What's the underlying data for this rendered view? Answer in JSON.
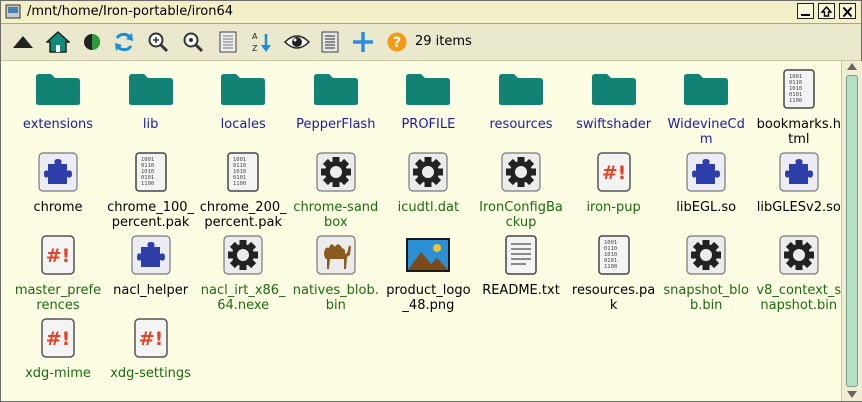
{
  "window": {
    "title": "/mnt/home/Iron-portable/iron64"
  },
  "toolbar": {
    "item_count": "29 items"
  },
  "files": [
    {
      "name": "extensions",
      "icon": "folder-icon",
      "kind": "dir"
    },
    {
      "name": "lib",
      "icon": "folder-icon",
      "kind": "dir"
    },
    {
      "name": "locales",
      "icon": "folder-icon",
      "kind": "dir"
    },
    {
      "name": "PepperFlash",
      "icon": "folder-icon",
      "kind": "dir"
    },
    {
      "name": "PROFILE",
      "icon": "folder-icon",
      "kind": "dir"
    },
    {
      "name": "resources",
      "icon": "folder-icon",
      "kind": "dir"
    },
    {
      "name": "swiftshader",
      "icon": "folder-icon",
      "kind": "dir"
    },
    {
      "name": "WidevineCdm",
      "icon": "folder-icon",
      "kind": "dir"
    },
    {
      "name": "bookmarks.html",
      "icon": "binary-file-icon",
      "kind": "file"
    },
    {
      "name": "chrome",
      "icon": "puzzle-icon",
      "kind": "file"
    },
    {
      "name": "chrome_100_percent.pak",
      "icon": "binary-file-icon",
      "kind": "file"
    },
    {
      "name": "chrome_200_percent.pak",
      "icon": "binary-file-icon",
      "kind": "file"
    },
    {
      "name": "chrome-sandbox",
      "icon": "gear-icon",
      "kind": "exec"
    },
    {
      "name": "icudtl.dat",
      "icon": "gear-icon",
      "kind": "exec"
    },
    {
      "name": "IronConfigBackup",
      "icon": "gear-icon",
      "kind": "exec"
    },
    {
      "name": "iron-pup",
      "icon": "script-icon",
      "kind": "exec"
    },
    {
      "name": "libEGL.so",
      "icon": "puzzle-icon",
      "kind": "file"
    },
    {
      "name": "libGLESv2.so",
      "icon": "puzzle-icon",
      "kind": "file"
    },
    {
      "name": "master_preferences",
      "icon": "script-icon",
      "kind": "exec"
    },
    {
      "name": "nacl_helper",
      "icon": "puzzle-icon",
      "kind": "file"
    },
    {
      "name": "nacl_irt_x86_64.nexe",
      "icon": "gear-icon",
      "kind": "exec"
    },
    {
      "name": "natives_blob.bin",
      "icon": "camel-icon",
      "kind": "exec"
    },
    {
      "name": "product_logo_48.png",
      "icon": "image-icon",
      "kind": "file"
    },
    {
      "name": "README.txt",
      "icon": "text-file-icon",
      "kind": "file"
    },
    {
      "name": "resources.pak",
      "icon": "binary-file-icon",
      "kind": "file"
    },
    {
      "name": "snapshot_blob.bin",
      "icon": "gear-icon",
      "kind": "exec"
    },
    {
      "name": "v8_context_snapshot.bin",
      "icon": "gear-icon",
      "kind": "exec"
    },
    {
      "name": "xdg-mime",
      "icon": "script-icon",
      "kind": "exec"
    },
    {
      "name": "xdg-settings",
      "icon": "script-icon",
      "kind": "exec"
    }
  ],
  "colors": {
    "folder": "#128274",
    "dir_text": "#1a1aa8",
    "exec_text": "#1a6a10",
    "script_text": "#e0452a",
    "puzzle": "#2d3ea8"
  }
}
